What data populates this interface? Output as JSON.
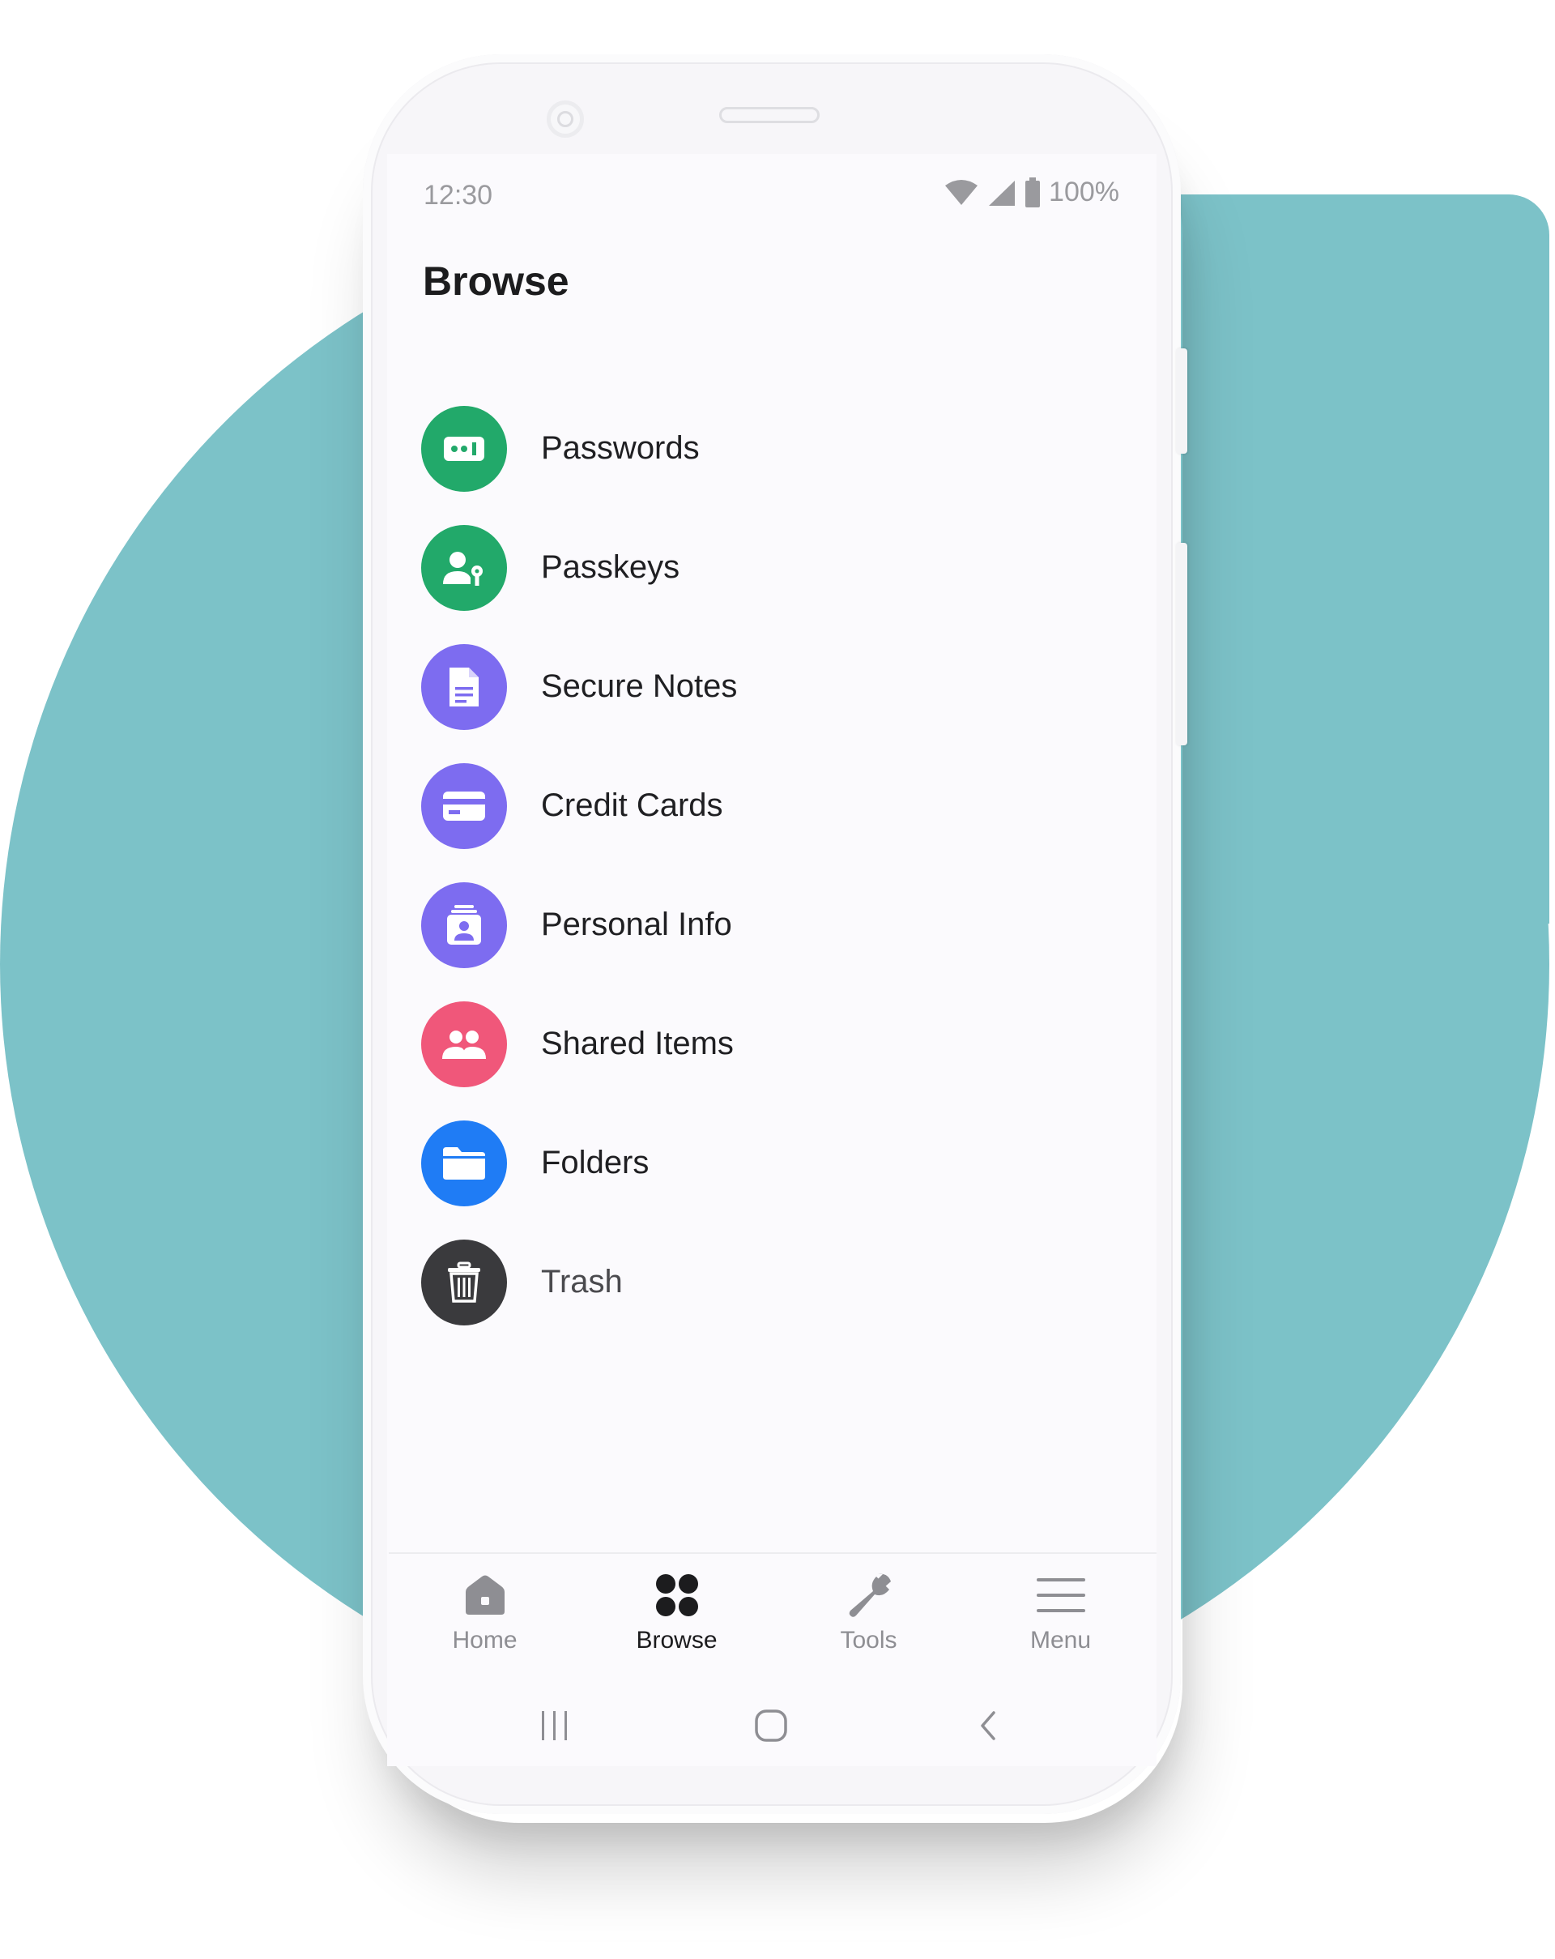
{
  "status_bar": {
    "time": "12:30",
    "battery": "100%"
  },
  "page": {
    "title": "Browse"
  },
  "browse_items": [
    {
      "label": "Passwords",
      "icon": "password-icon",
      "color": "#22a96a"
    },
    {
      "label": "Passkeys",
      "icon": "passkey-icon",
      "color": "#22a96a"
    },
    {
      "label": "Secure Notes",
      "icon": "note-icon",
      "color": "#7d6cf0"
    },
    {
      "label": "Credit Cards",
      "icon": "credit-card-icon",
      "color": "#7d6cf0"
    },
    {
      "label": "Personal Info",
      "icon": "personal-info-icon",
      "color": "#7d6cf0"
    },
    {
      "label": "Shared Items",
      "icon": "shared-users-icon",
      "color": "#f0577a"
    },
    {
      "label": "Folders",
      "icon": "folder-icon",
      "color": "#1f7cf5"
    },
    {
      "label": "Trash",
      "icon": "trash-icon",
      "color": "#3a3a3d"
    }
  ],
  "bottom_nav": [
    {
      "label": "Home",
      "icon": "home-icon",
      "active": false
    },
    {
      "label": "Browse",
      "icon": "browse-grid-icon",
      "active": true
    },
    {
      "label": "Tools",
      "icon": "wrench-icon",
      "active": false
    },
    {
      "label": "Menu",
      "icon": "hamburger-menu-icon",
      "active": false
    }
  ],
  "colors": {
    "background_teal": "#7cc2c8",
    "green": "#22a96a",
    "purple": "#7d6cf0",
    "pink": "#f0577a",
    "blue": "#1f7cf5",
    "dark": "#3a3a3d"
  }
}
